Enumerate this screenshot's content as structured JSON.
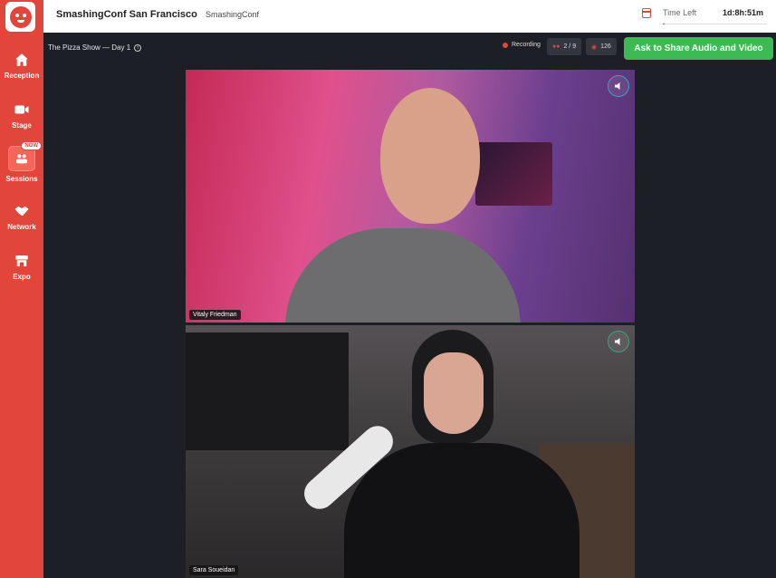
{
  "sidebar": {
    "logo_icon": "cat-logo-icon",
    "items": [
      {
        "label": "Reception",
        "icon": "home-icon"
      },
      {
        "label": "Stage",
        "icon": "video-camera-icon"
      },
      {
        "label": "Sessions",
        "icon": "sessions-icon",
        "badge": "NOW"
      },
      {
        "label": "Network",
        "icon": "handshake-icon"
      },
      {
        "label": "Expo",
        "icon": "booth-icon"
      }
    ]
  },
  "topbar": {
    "event_title": "SmashingConf San Francisco",
    "organizer": "SmashingConf",
    "time_left_label": "Time Left",
    "time_left_value": "1d:8h:51m"
  },
  "stage": {
    "title": "The Pizza Show — Day 1",
    "recording_label": "Recording",
    "speakers_count": "2 / 9",
    "viewers_count": "126",
    "share_button": "Ask to Share Audio and Video"
  },
  "videos": [
    {
      "name": "Vitaly Friedman"
    },
    {
      "name": "Sara Soueidan"
    }
  ],
  "colors": {
    "brand": "#e2453a",
    "share_green": "#3dba54",
    "dark_bg": "#1d1f27"
  }
}
